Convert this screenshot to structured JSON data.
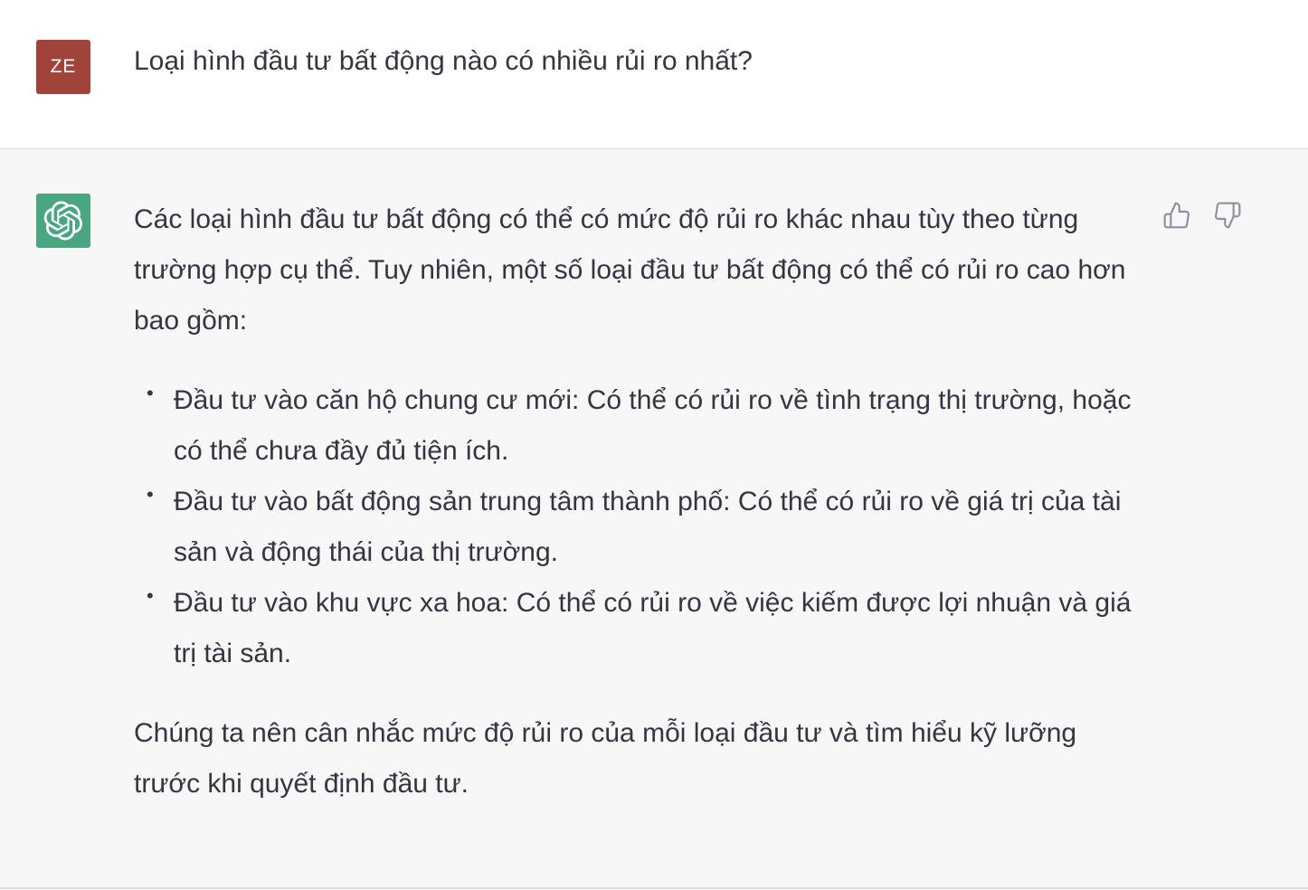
{
  "user_message": {
    "avatar_initials": "ZE",
    "text": "Loại hình đầu tư bất động nào có nhiều rủi ro nhất?"
  },
  "assistant_message": {
    "intro": "Các loại hình đầu tư bất động có thể có mức độ rủi ro khác nhau tùy theo từng trường hợp cụ thể. Tuy nhiên, một số loại đầu tư bất động có thể có rủi ro cao hơn bao gồm:",
    "bullets": [
      "Đầu tư vào căn hộ chung cư mới: Có thể có rủi ro về tình trạng thị trường, hoặc có thể chưa đầy đủ tiện ích.",
      "Đầu tư vào bất động sản trung tâm thành phố: Có thể có rủi ro về giá trị của tài sản và động thái của thị trường.",
      "Đầu tư vào khu vực xa hoa: Có thể có rủi ro về việc kiếm được lợi nhuận và giá trị tài sản."
    ],
    "conclusion": "Chúng ta nên cân nhắc mức độ rủi ro của mỗi loại đầu tư và tìm hiểu kỹ lưỡng trước khi quyết định đầu tư."
  },
  "icons": {
    "bot_avatar": "openai-logo-icon",
    "thumb_up": "thumbs-up-icon",
    "thumb_down": "thumbs-down-icon"
  },
  "colors": {
    "user_avatar_bg": "#a0433a",
    "bot_avatar_bg": "#4aa583",
    "assistant_bg": "#f7f7f8",
    "text": "#343541"
  }
}
